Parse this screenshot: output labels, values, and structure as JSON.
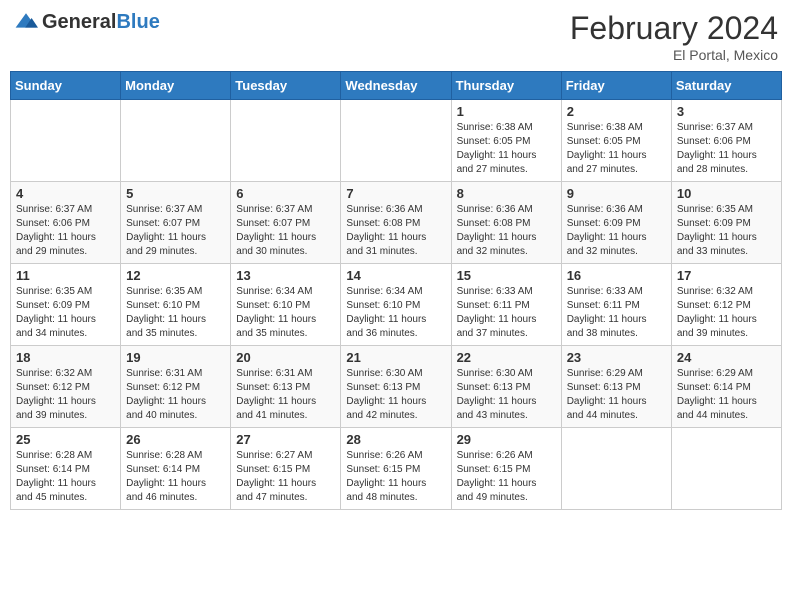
{
  "header": {
    "logo_general": "General",
    "logo_blue": "Blue",
    "month_title": "February 2024",
    "location": "El Portal, Mexico"
  },
  "days_of_week": [
    "Sunday",
    "Monday",
    "Tuesday",
    "Wednesday",
    "Thursday",
    "Friday",
    "Saturday"
  ],
  "weeks": [
    [
      {
        "day": "",
        "info": ""
      },
      {
        "day": "",
        "info": ""
      },
      {
        "day": "",
        "info": ""
      },
      {
        "day": "",
        "info": ""
      },
      {
        "day": "1",
        "info": "Sunrise: 6:38 AM\nSunset: 6:05 PM\nDaylight: 11 hours and 27 minutes."
      },
      {
        "day": "2",
        "info": "Sunrise: 6:38 AM\nSunset: 6:05 PM\nDaylight: 11 hours and 27 minutes."
      },
      {
        "day": "3",
        "info": "Sunrise: 6:37 AM\nSunset: 6:06 PM\nDaylight: 11 hours and 28 minutes."
      }
    ],
    [
      {
        "day": "4",
        "info": "Sunrise: 6:37 AM\nSunset: 6:06 PM\nDaylight: 11 hours and 29 minutes."
      },
      {
        "day": "5",
        "info": "Sunrise: 6:37 AM\nSunset: 6:07 PM\nDaylight: 11 hours and 29 minutes."
      },
      {
        "day": "6",
        "info": "Sunrise: 6:37 AM\nSunset: 6:07 PM\nDaylight: 11 hours and 30 minutes."
      },
      {
        "day": "7",
        "info": "Sunrise: 6:36 AM\nSunset: 6:08 PM\nDaylight: 11 hours and 31 minutes."
      },
      {
        "day": "8",
        "info": "Sunrise: 6:36 AM\nSunset: 6:08 PM\nDaylight: 11 hours and 32 minutes."
      },
      {
        "day": "9",
        "info": "Sunrise: 6:36 AM\nSunset: 6:09 PM\nDaylight: 11 hours and 32 minutes."
      },
      {
        "day": "10",
        "info": "Sunrise: 6:35 AM\nSunset: 6:09 PM\nDaylight: 11 hours and 33 minutes."
      }
    ],
    [
      {
        "day": "11",
        "info": "Sunrise: 6:35 AM\nSunset: 6:09 PM\nDaylight: 11 hours and 34 minutes."
      },
      {
        "day": "12",
        "info": "Sunrise: 6:35 AM\nSunset: 6:10 PM\nDaylight: 11 hours and 35 minutes."
      },
      {
        "day": "13",
        "info": "Sunrise: 6:34 AM\nSunset: 6:10 PM\nDaylight: 11 hours and 35 minutes."
      },
      {
        "day": "14",
        "info": "Sunrise: 6:34 AM\nSunset: 6:10 PM\nDaylight: 11 hours and 36 minutes."
      },
      {
        "day": "15",
        "info": "Sunrise: 6:33 AM\nSunset: 6:11 PM\nDaylight: 11 hours and 37 minutes."
      },
      {
        "day": "16",
        "info": "Sunrise: 6:33 AM\nSunset: 6:11 PM\nDaylight: 11 hours and 38 minutes."
      },
      {
        "day": "17",
        "info": "Sunrise: 6:32 AM\nSunset: 6:12 PM\nDaylight: 11 hours and 39 minutes."
      }
    ],
    [
      {
        "day": "18",
        "info": "Sunrise: 6:32 AM\nSunset: 6:12 PM\nDaylight: 11 hours and 39 minutes."
      },
      {
        "day": "19",
        "info": "Sunrise: 6:31 AM\nSunset: 6:12 PM\nDaylight: 11 hours and 40 minutes."
      },
      {
        "day": "20",
        "info": "Sunrise: 6:31 AM\nSunset: 6:13 PM\nDaylight: 11 hours and 41 minutes."
      },
      {
        "day": "21",
        "info": "Sunrise: 6:30 AM\nSunset: 6:13 PM\nDaylight: 11 hours and 42 minutes."
      },
      {
        "day": "22",
        "info": "Sunrise: 6:30 AM\nSunset: 6:13 PM\nDaylight: 11 hours and 43 minutes."
      },
      {
        "day": "23",
        "info": "Sunrise: 6:29 AM\nSunset: 6:13 PM\nDaylight: 11 hours and 44 minutes."
      },
      {
        "day": "24",
        "info": "Sunrise: 6:29 AM\nSunset: 6:14 PM\nDaylight: 11 hours and 44 minutes."
      }
    ],
    [
      {
        "day": "25",
        "info": "Sunrise: 6:28 AM\nSunset: 6:14 PM\nDaylight: 11 hours and 45 minutes."
      },
      {
        "day": "26",
        "info": "Sunrise: 6:28 AM\nSunset: 6:14 PM\nDaylight: 11 hours and 46 minutes."
      },
      {
        "day": "27",
        "info": "Sunrise: 6:27 AM\nSunset: 6:15 PM\nDaylight: 11 hours and 47 minutes."
      },
      {
        "day": "28",
        "info": "Sunrise: 6:26 AM\nSunset: 6:15 PM\nDaylight: 11 hours and 48 minutes."
      },
      {
        "day": "29",
        "info": "Sunrise: 6:26 AM\nSunset: 6:15 PM\nDaylight: 11 hours and 49 minutes."
      },
      {
        "day": "",
        "info": ""
      },
      {
        "day": "",
        "info": ""
      }
    ]
  ]
}
